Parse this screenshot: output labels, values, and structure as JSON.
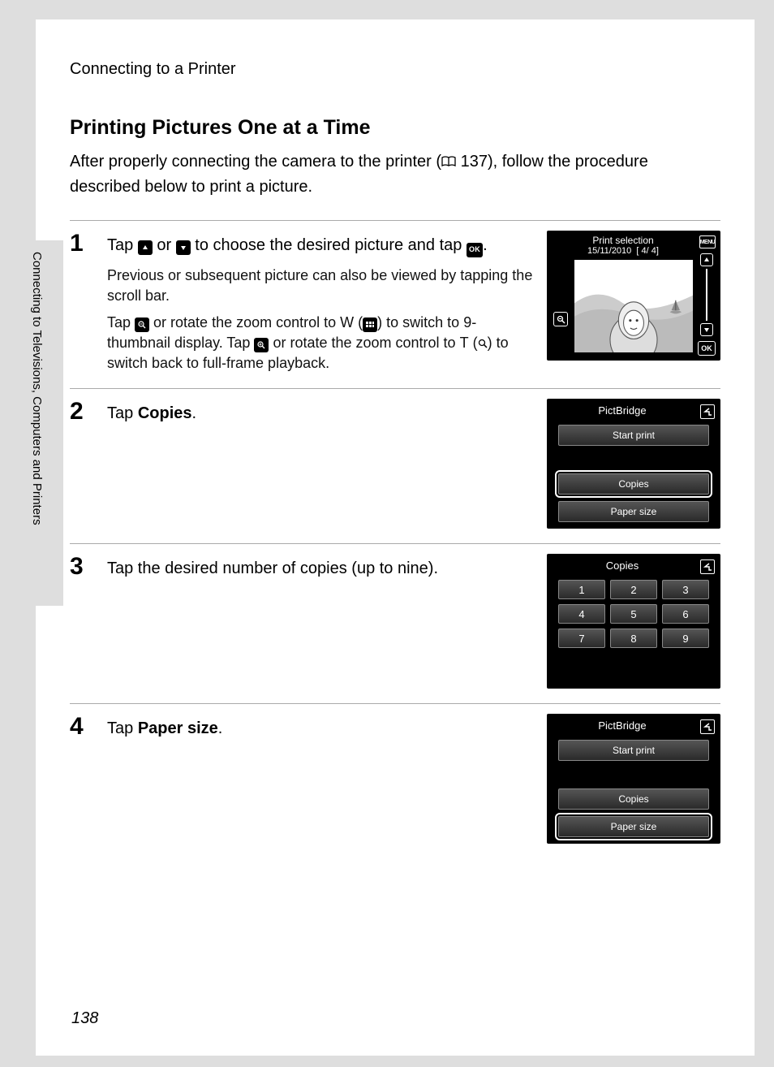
{
  "header": "Connecting to a Printer",
  "section_title": "Printing Pictures One at a Time",
  "intro_before_ref": "After properly connecting the camera to the printer (",
  "intro_ref": " 137",
  "intro_after_ref": "), follow the procedure described below to print a picture.",
  "sidebar": "Connecting to Televisions, Computers and Printers",
  "page_number": "138",
  "steps": {
    "s1": {
      "num": "1",
      "head_a": "Tap ",
      "head_b": " or ",
      "head_c": " to choose the desired picture and tap ",
      "head_d": ".",
      "detail1": "Previous or subsequent picture can also be viewed by tapping the scroll bar.",
      "detail2_a": "Tap ",
      "detail2_b": " or rotate the zoom control to ",
      "detail2_w": "W",
      "detail2_c": " (",
      "detail2_d": ") to switch to 9-thumbnail display. Tap ",
      "detail2_e": " or rotate the zoom control to ",
      "detail2_t": "T",
      "detail2_f": " (",
      "detail2_g": ") to switch back to full-frame playback."
    },
    "s2": {
      "num": "2",
      "head_a": "Tap ",
      "head_b": "Copies",
      "head_c": "."
    },
    "s3": {
      "num": "3",
      "head": "Tap the desired number of copies (up to nine)."
    },
    "s4": {
      "num": "4",
      "head_a": "Tap ",
      "head_b": "Paper size",
      "head_c": "."
    }
  },
  "screen1": {
    "title": "Print selection",
    "date": "15/11/2010",
    "counter": "[      4/      4]",
    "menu": "MENU",
    "ok": "OK"
  },
  "screen2": {
    "title": "PictBridge",
    "start": "Start print",
    "copies": "Copies",
    "paper": "Paper size"
  },
  "screen3": {
    "title": "Copies",
    "nums": [
      "1",
      "2",
      "3",
      "4",
      "5",
      "6",
      "7",
      "8",
      "9"
    ]
  },
  "screen4": {
    "title": "PictBridge",
    "start": "Start print",
    "copies": "Copies",
    "paper": "Paper size"
  }
}
